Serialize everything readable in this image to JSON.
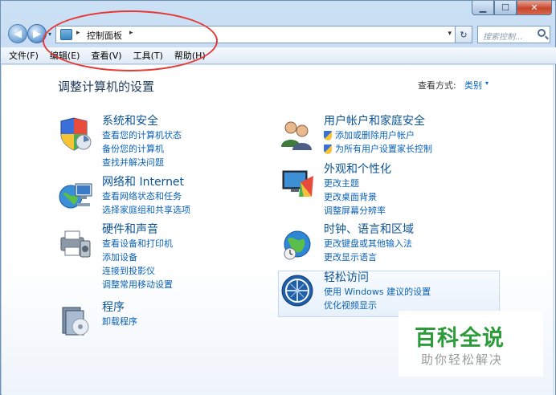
{
  "window": {
    "caption_buttons": {
      "minimize": "▁",
      "maximize": "☐",
      "close": "✕"
    }
  },
  "nav": {
    "back_icon": "◀",
    "forward_icon": "▶",
    "dropdown_icon": "▾"
  },
  "address": {
    "separator": "▸",
    "location": "控制面板",
    "trailing_separator": "▸",
    "dropdown_icon": "▾"
  },
  "refresh_icon": "↻",
  "search": {
    "placeholder": "搜索控制..."
  },
  "menu": {
    "items": [
      "文件(F)",
      "编辑(E)",
      "查看(V)",
      "工具(T)",
      "帮助(H)"
    ]
  },
  "main": {
    "title": "调整计算机的设置",
    "view_by_label": "查看方式:",
    "view_by_value": "类别",
    "view_by_caret": "▾"
  },
  "categories": {
    "system_security": {
      "title": "系统和安全",
      "links": [
        "查看您的计算机状态",
        "备份您的计算机",
        "查找并解决问题"
      ]
    },
    "network": {
      "title": "网络和 Internet",
      "links": [
        "查看网络状态和任务",
        "选择家庭组和共享选项"
      ]
    },
    "hardware": {
      "title": "硬件和声音",
      "links": [
        "查看设备和打印机",
        "添加设备",
        "连接到投影仪",
        "调整常用移动设置"
      ]
    },
    "programs": {
      "title": "程序",
      "links": [
        "卸载程序"
      ]
    },
    "user_accounts": {
      "title": "用户帐户和家庭安全",
      "links": [
        "添加或删除用户帐户",
        "为所有用户设置家长控制"
      ]
    },
    "appearance": {
      "title": "外观和个性化",
      "links": [
        "更改主题",
        "更改桌面背景",
        "调整屏幕分辨率"
      ]
    },
    "clock": {
      "title": "时钟、语言和区域",
      "links": [
        "更改键盘或其他输入法",
        "更改显示语言"
      ]
    },
    "ease": {
      "title": "轻松访问",
      "links": [
        "使用 Windows 建议的设置",
        "优化视频显示"
      ]
    }
  },
  "watermark": {
    "title": "百科全说",
    "subtitle": "助你轻松解决"
  },
  "colors": {
    "link": "#0b62b8",
    "category_title": "#0b5394",
    "annotation": "#e53935",
    "watermark_green": "#2c9c3a"
  }
}
